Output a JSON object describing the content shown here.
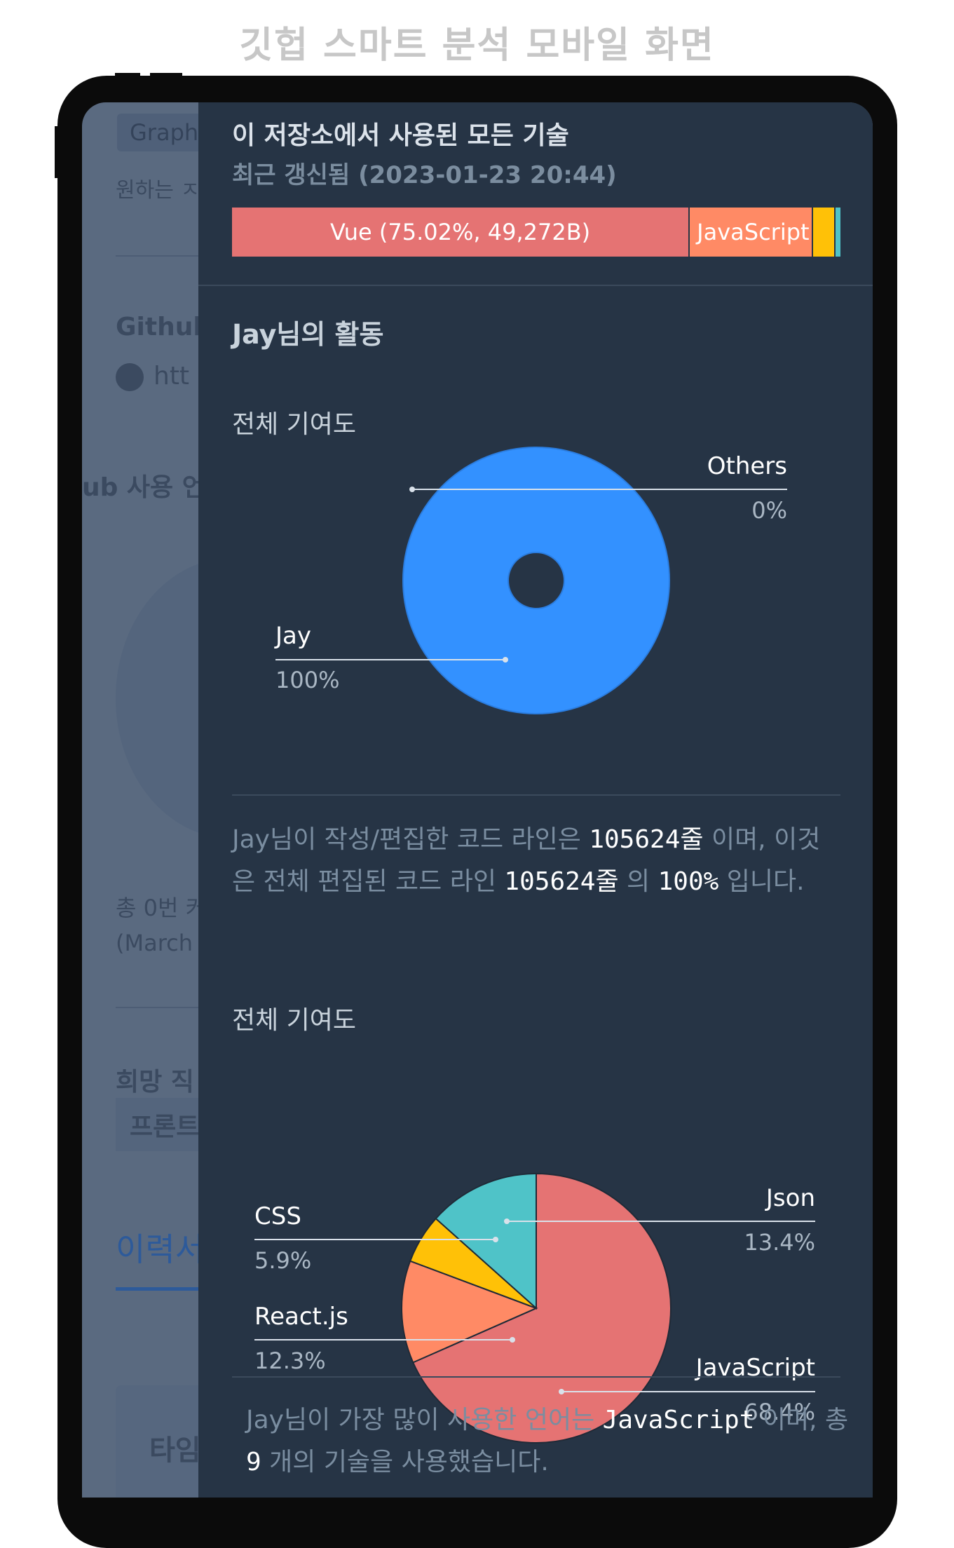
{
  "page_title": "깃헙 스마트 분석 모바일 화면",
  "background_page": {
    "chip_label": "Graph",
    "hint_text": "원하는 ㅈ",
    "github_label": "Github",
    "link_text": "htt",
    "usage_label": "ub 사용 언",
    "total_text": "총 0번 커",
    "date_text": "(March",
    "job_label": "희망 직",
    "job_value": "프론트",
    "tab_label": "이력서",
    "card_label": "타임"
  },
  "repo": {
    "title": "이 저장소에서 사용된 모든 기술",
    "updated": "최근 갱신됨 (2023-01-23 20:44)",
    "languages": [
      {
        "name": "Vue",
        "label": "Vue (75.02%, 49,272B)",
        "percent": 75.02,
        "color": "#e57373"
      },
      {
        "name": "JavaScript",
        "label": "JavaScript",
        "percent": 20.2,
        "color": "#ff8a65"
      },
      {
        "name": "lang-3",
        "label": "",
        "percent": 3.8,
        "color": "#ffc107"
      },
      {
        "name": "lang-4",
        "label": "",
        "percent": 0.98,
        "color": "#4fc3c8"
      }
    ]
  },
  "activity": {
    "title": "Jay님의 활동",
    "contribution_title": "전체 기여도",
    "language_title": "전체 기여도",
    "lines_desc": {
      "part1": "Jay님이 작성/편집한 코드 라인은 ",
      "user_lines": "105624줄",
      "part2": " 이며, 이것은 전체 편집된 코드 라인 ",
      "total_lines": "105624줄",
      "part3": " 의 ",
      "percent": "100%",
      "part4": " 입니다."
    },
    "lang_desc": {
      "part1": "Jay님이 가장 많이 사용한 언어는 ",
      "top_language": "JavaScript",
      "part2": " 이며, 총 ",
      "count": "9",
      "part3": " 개의 기술을 사용했습니다."
    }
  },
  "chart_data": [
    {
      "type": "pie",
      "variant": "donut",
      "title": "전체 기여도",
      "slices": [
        {
          "label": "Jay",
          "value": 100,
          "display": "100%",
          "color": "#3391ff"
        },
        {
          "label": "Others",
          "value": 0,
          "display": "0%",
          "color": "#e57373"
        }
      ]
    },
    {
      "type": "pie",
      "title": "전체 기여도",
      "slices": [
        {
          "label": "JavaScript",
          "value": 68.4,
          "display": "68.4%",
          "color": "#e57373"
        },
        {
          "label": "React.js",
          "value": 12.3,
          "display": "12.3%",
          "color": "#ff8a65"
        },
        {
          "label": "CSS",
          "value": 5.9,
          "display": "5.9%",
          "color": "#ffc107"
        },
        {
          "label": "Json",
          "value": 13.4,
          "display": "13.4%",
          "color": "#4fc3c8"
        }
      ]
    }
  ]
}
